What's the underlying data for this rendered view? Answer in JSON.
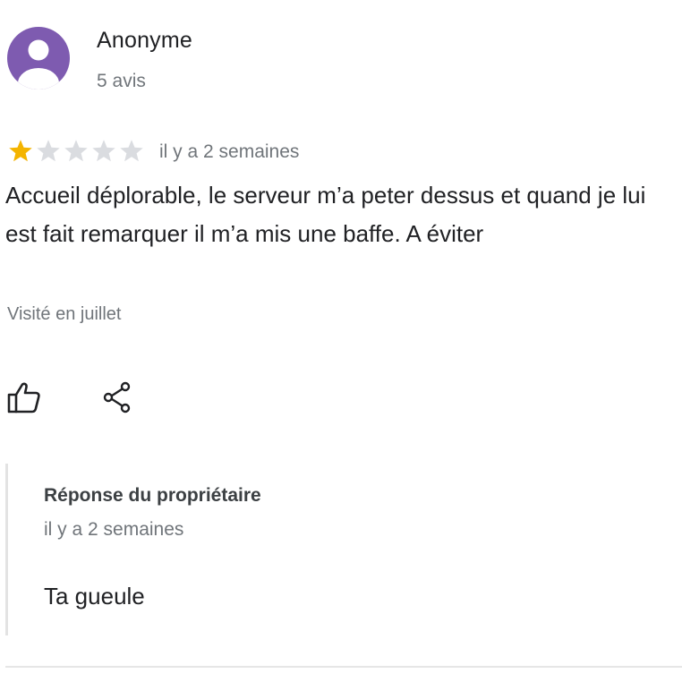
{
  "review": {
    "author": {
      "name": "Anonyme",
      "review_count": "5 avis",
      "avatar_icon": "person-icon",
      "avatar_color": "#7e5bb0"
    },
    "rating": {
      "value": 1,
      "max": 5,
      "filled_color": "#f4b400",
      "empty_color": "#dadce0"
    },
    "time": "il y a 2 semaines",
    "text": "Accueil déplorable, le serveur m’a peter dessus et quand je lui est fait remarquer il m’a mis une baffe. A éviter",
    "visit": "Visité en juillet",
    "actions": {
      "like_icon": "thumbs-up-icon",
      "share_icon": "share-icon"
    }
  },
  "owner_reply": {
    "title": "Réponse du propriétaire",
    "time": "il y a 2 semaines",
    "text": "Ta gueule"
  }
}
